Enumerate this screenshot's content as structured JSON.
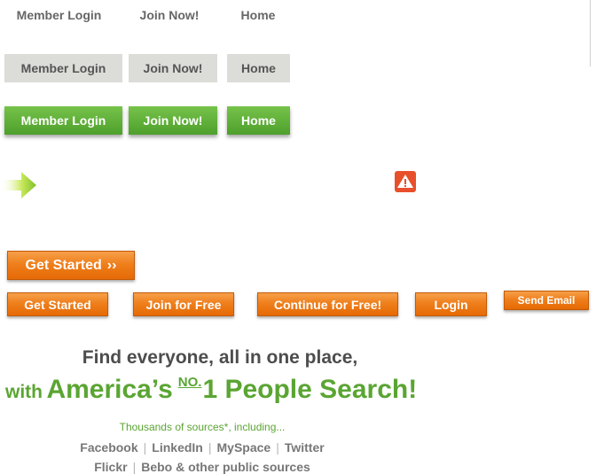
{
  "nav_rows": {
    "plain": [
      "Member Login",
      "Join Now!",
      "Home"
    ],
    "gray": [
      "Member Login",
      "Join Now!",
      "Home"
    ],
    "green": [
      "Member Login",
      "Join Now!",
      "Home"
    ]
  },
  "icons": {
    "arrow": "arrow-right-icon",
    "warning": "warning-icon"
  },
  "buttons": {
    "get_started_arrow": "Get Started",
    "get_started_arrow_glyph": "››",
    "get_started": "Get Started",
    "join_free": "Join for Free",
    "continue_free": "Continue for Free!",
    "login": "Login",
    "send_email": "Send Email"
  },
  "headline": {
    "line1": "Find everyone, all in one place,",
    "with": "with",
    "america": "America’s",
    "no": "NO.",
    "rest": "1 People Search!"
  },
  "sources": {
    "intro": "Thousands of sources*, including...",
    "row1": [
      "Facebook",
      "LinkedIn",
      "MySpace",
      "Twitter"
    ],
    "row2": [
      "Flickr",
      "Bebo & other public sources"
    ]
  },
  "colors": {
    "green_accent": "#5aa532",
    "orange_accent": "#ef7f1c",
    "warning_red": "#e8502c"
  }
}
